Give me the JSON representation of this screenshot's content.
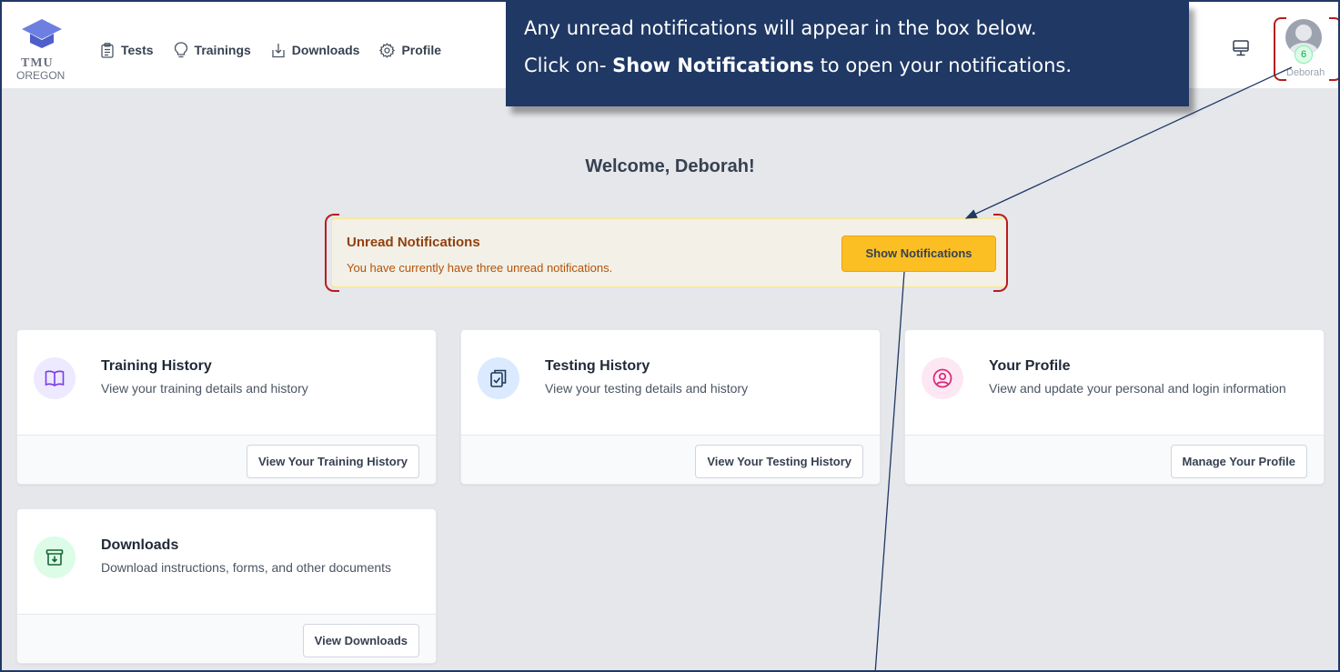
{
  "app": {
    "logo_line1": "TMU",
    "logo_line2": "OREGON"
  },
  "nav": {
    "items": [
      {
        "label": "Tests",
        "icon": "clipboard-list-icon"
      },
      {
        "label": "Trainings",
        "icon": "lightbulb-icon"
      },
      {
        "label": "Downloads",
        "icon": "download-tray-icon"
      },
      {
        "label": "Profile",
        "icon": "gear-icon"
      }
    ]
  },
  "user": {
    "name": "Deborah",
    "notification_count": "6"
  },
  "callout": {
    "line1": "Any unread notifications will appear in the box below.",
    "line2_prefix": "Click on- ",
    "line2_bold": "Show Notifications",
    "line2_suffix": " to open your notifications."
  },
  "welcome": "Welcome, Deborah!",
  "notifications": {
    "title": "Unread Notifications",
    "text": "You have currently have three unread notifications.",
    "button": "Show Notifications"
  },
  "cards": [
    {
      "title": "Training History",
      "desc": "View your training details and history",
      "button": "View Your Training History",
      "icon": "book-open-icon"
    },
    {
      "title": "Testing History",
      "desc": "View your testing details and history",
      "button": "View Your Testing History",
      "icon": "clipboard-check-icon"
    },
    {
      "title": "Your Profile",
      "desc": "View and update your personal and login information",
      "button": "Manage Your Profile",
      "icon": "user-circle-icon"
    },
    {
      "title": "Downloads",
      "desc": "Download instructions, forms, and other documents",
      "button": "View Downloads",
      "icon": "archive-download-icon"
    }
  ],
  "colors": {
    "accent_navy": "#1f3864",
    "annotation_red": "#b91c1c",
    "notif_button": "#fbbf24",
    "training_icon_bg": "#ede9fe",
    "testing_icon_bg": "#dbeafe",
    "profile_icon_bg": "#fce7f3",
    "downloads_icon_bg": "#dcfce7"
  }
}
